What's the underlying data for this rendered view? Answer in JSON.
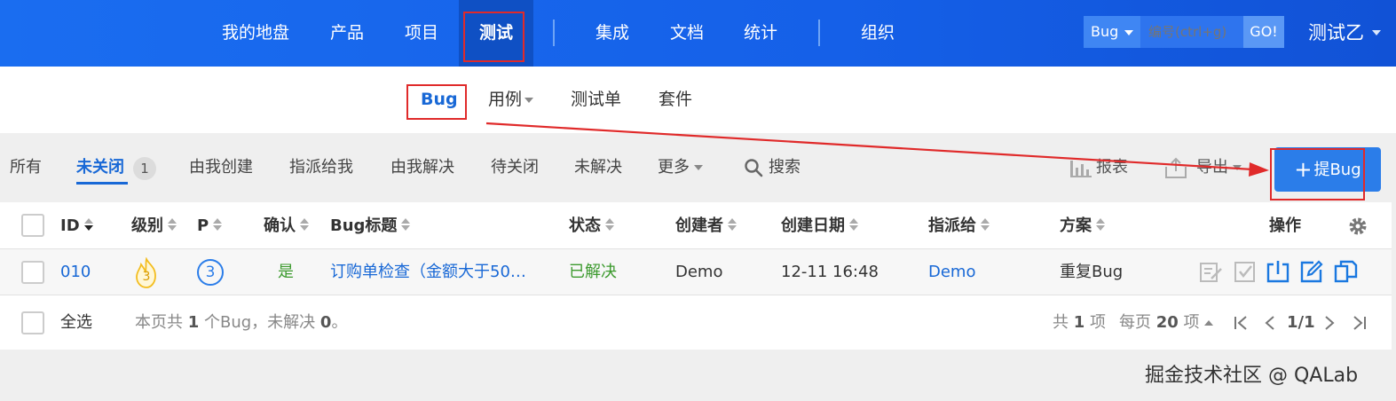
{
  "top_nav": {
    "items": [
      "我的地盘",
      "产品",
      "项目",
      "测试",
      "集成",
      "文档",
      "统计",
      "组织"
    ],
    "active": "测试"
  },
  "search": {
    "type": "Bug",
    "placeholder": "编号(ctrl+g)",
    "go_label": "GO!"
  },
  "user": {
    "name": "测试乙"
  },
  "sub_nav": {
    "items": [
      "Bug",
      "用例",
      "测试单",
      "套件"
    ],
    "active": "Bug"
  },
  "filters": {
    "items": [
      "所有",
      "未关闭",
      "由我创建",
      "指派给我",
      "由我解决",
      "待关闭",
      "未解决",
      "更多"
    ],
    "active": "未关闭",
    "active_count": "1",
    "search_label": "搜索"
  },
  "toolbar": {
    "report_label": "报表",
    "export_label": "导出",
    "add_label": "提Bug"
  },
  "table": {
    "columns": [
      "ID",
      "级别",
      "P",
      "确认",
      "Bug标题",
      "状态",
      "创建者",
      "创建日期",
      "指派给",
      "方案",
      "操作"
    ],
    "rows": [
      {
        "id": "010",
        "severity": "3",
        "priority": "3",
        "confirmed": "是",
        "title": "订购单检查（金额大于50…",
        "status": "已解决",
        "creator": "Demo",
        "created": "12-11 16:48",
        "assigned": "Demo",
        "resolution": "重复Bug"
      }
    ],
    "actions": [
      "confirm-icon",
      "check-icon",
      "close-bug-icon",
      "edit-icon",
      "copy-icon"
    ]
  },
  "footer": {
    "select_all": "全选",
    "summary_prefix": "本页共",
    "summary_count": "1",
    "summary_mid": "个Bug，未解决",
    "summary_unresolved": "0",
    "summary_suffix": "。",
    "total_prefix": "共",
    "total_count": "1",
    "total_suffix": "项",
    "per_page_prefix": "每页",
    "per_page": "20",
    "per_page_suffix": "项",
    "page": "1/1"
  },
  "watermark": "掘金技术社区 @ QALab",
  "colors": {
    "nav_bg": "#1a6df0",
    "accent": "#1868d6",
    "annotation": "#e02a2a",
    "resolved": "#3c9a2e"
  }
}
